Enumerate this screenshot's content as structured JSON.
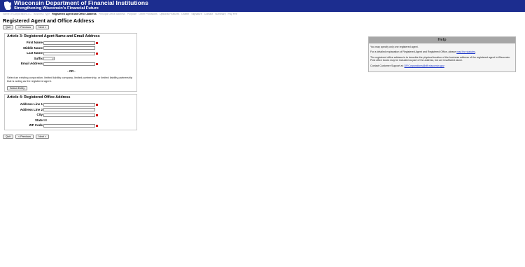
{
  "header": {
    "title": "Wisconsin Department of Financial Institutions",
    "subtitle": "Strengthening Wisconsin's Financial Future"
  },
  "steps": [
    {
      "label": "Name of Corporation/LLC",
      "current": false
    },
    {
      "label": "Business Type",
      "current": false
    },
    {
      "label": "Registered Agent and Office Address",
      "current": true
    },
    {
      "label": "Principal Office Address",
      "current": false
    },
    {
      "label": "Purpose",
      "current": false
    },
    {
      "label": "Other Provisions",
      "current": false
    },
    {
      "label": "Optional Features",
      "current": false
    },
    {
      "label": "Drafter",
      "current": false
    },
    {
      "label": "Signature",
      "current": false
    },
    {
      "label": "Contact",
      "current": false
    },
    {
      "label": "Summary",
      "current": false
    },
    {
      "label": "Pay Fee",
      "current": false
    }
  ],
  "page_title": "Registered Agent and Office Address",
  "buttons": {
    "quit": "Quit",
    "previous": "< Previous",
    "next": "Next >"
  },
  "article3": {
    "title": "Article 3: Registered Agent Name and Email Address",
    "first_name": "First Name",
    "middle_name": "Middle Name",
    "last_name": "Last Name",
    "suffix": "Suffix",
    "email": "Email Address",
    "or_text": "- OR -",
    "note": "Select an existing corporation, limited liability company, limited partnership, or limited liability partnership that is acting as the registered agent.",
    "select_entity": "Select Entity"
  },
  "article4": {
    "title": "Article 4: Registered Office Address",
    "address1": "Address Line 1",
    "address2": "Address Line 2",
    "city": "City",
    "state": "State",
    "state_value": "WI",
    "zip": "ZIP Code"
  },
  "help": {
    "heading": "Help",
    "p1": "You may specify only one registered agent.",
    "p2_pre": "For a detailed explanation of Registered Agent and Registered Office, please ",
    "p2_link": "read the statutes",
    "p2_post": ".",
    "p3": "The registered office address is to describe the physical location of the business address of the registered agent in Wisconsin. Post office boxes may be included as part of the address, but are insufficient alone.",
    "p4_pre": "Contact Customer Support at: ",
    "p4_link": "DFICorporations@dfi.wisconsin.gov"
  },
  "colors": {
    "banner": "#1c2d8f",
    "required": "#d01010",
    "link": "#1a34c8",
    "help_header": "#a6a6a6"
  }
}
